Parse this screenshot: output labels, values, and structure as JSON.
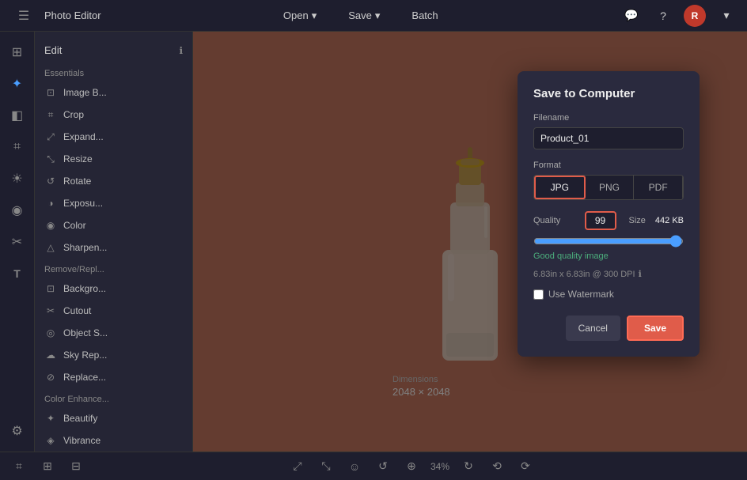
{
  "app": {
    "name": "Photo Editor"
  },
  "topbar": {
    "open_label": "Open",
    "save_label": "Save",
    "batch_label": "Batch",
    "chevron": "▾"
  },
  "sidebar_icons": [
    {
      "name": "grid-icon",
      "symbol": "⊞"
    },
    {
      "name": "magic-icon",
      "symbol": "✦"
    },
    {
      "name": "layers-icon",
      "symbol": "◧"
    },
    {
      "name": "crop-tool-icon",
      "symbol": "⌗"
    },
    {
      "name": "adjust-icon",
      "symbol": "☀"
    },
    {
      "name": "color-icon",
      "symbol": "◉"
    },
    {
      "name": "remove-icon",
      "symbol": "✂"
    },
    {
      "name": "text-icon",
      "symbol": "T"
    },
    {
      "name": "settings-icon",
      "symbol": "⚙"
    }
  ],
  "left_panel": {
    "header": "Edit",
    "info_icon": "ℹ",
    "sections": [
      {
        "title": "Essentials",
        "items": [
          {
            "icon": "image-basic-icon",
            "symbol": "⊡",
            "label": "Image B..."
          },
          {
            "icon": "crop-icon",
            "symbol": "⌗",
            "label": "Crop"
          },
          {
            "icon": "expand-icon",
            "symbol": "⤢",
            "label": "Expand..."
          },
          {
            "icon": "resize-icon",
            "symbol": "⤡",
            "label": "Resize"
          },
          {
            "icon": "rotate-icon",
            "symbol": "↺",
            "label": "Rotate"
          },
          {
            "icon": "exposure-icon",
            "symbol": "◑",
            "label": "Exposu..."
          },
          {
            "icon": "color-adj-icon",
            "symbol": "◉",
            "label": "Color"
          },
          {
            "icon": "sharpen-icon",
            "symbol": "△",
            "label": "Sharpen..."
          }
        ]
      },
      {
        "title": "Remove/Repl...",
        "items": [
          {
            "icon": "background-icon",
            "symbol": "⊡",
            "label": "Backgro..."
          },
          {
            "icon": "cutout-icon",
            "symbol": "✂",
            "label": "Cutout"
          },
          {
            "icon": "object-icon",
            "symbol": "◎",
            "label": "Object S..."
          },
          {
            "icon": "sky-icon",
            "symbol": "☁",
            "label": "Sky Rep..."
          },
          {
            "icon": "replace-icon",
            "symbol": "⊘",
            "label": "Replace..."
          }
        ]
      },
      {
        "title": "Color Enhance...",
        "items": [
          {
            "icon": "beautify-icon",
            "symbol": "✦",
            "label": "Beautify"
          },
          {
            "icon": "vibrance-icon",
            "symbol": "◈",
            "label": "Vibrance"
          }
        ]
      }
    ]
  },
  "canvas": {
    "bg_color": "#c87860"
  },
  "dimensions": {
    "label": "Dimensions",
    "value": "2048 × 2048"
  },
  "bottombar": {
    "zoom_percent": "34%",
    "icons": [
      "crop-bottom-icon",
      "adjust-bottom-icon",
      "grid-bottom-icon",
      "fit-icon",
      "expand-bottom-icon",
      "emoji-icon",
      "undo-icon",
      "zoom-in-icon",
      "redo-icon",
      "rotate-left-icon",
      "rotate-right-icon"
    ]
  },
  "save_dialog": {
    "title": "Save to Computer",
    "filename_label": "Filename",
    "filename_value": "Product_01",
    "format_label": "Format",
    "formats": [
      "JPG",
      "PNG",
      "PDF"
    ],
    "active_format": "JPG",
    "quality_label": "Quality",
    "quality_value": "99",
    "size_label": "Size",
    "size_value": "442 KB",
    "quality_note": "Good quality image",
    "dpi_info": "6.83in x 6.83in @ 300 DPI",
    "info_icon": "ℹ",
    "watermark_label": "Use Watermark",
    "cancel_label": "Cancel",
    "save_label": "Save"
  }
}
